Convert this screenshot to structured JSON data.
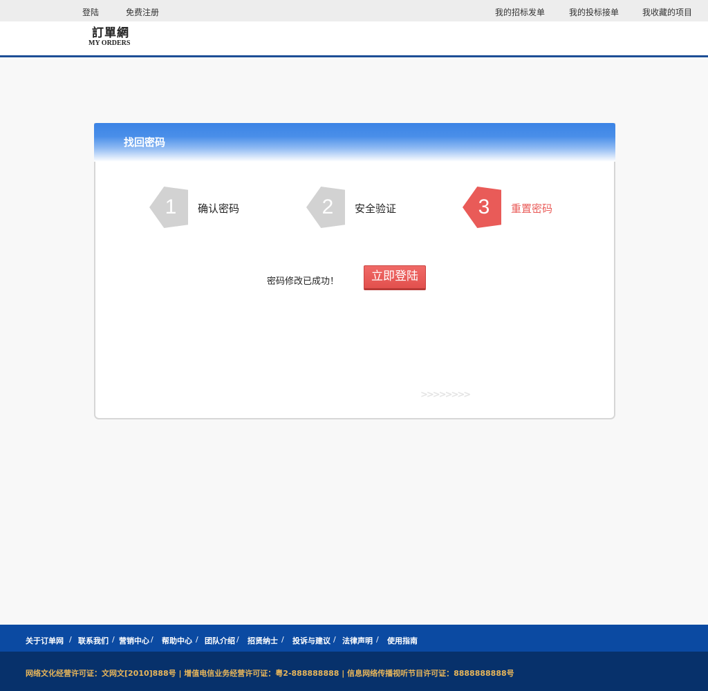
{
  "topbar": {
    "login": "登陆",
    "register": "免费注册",
    "my_bids_posted": "我的招标发单",
    "my_bids_received": "我的投标接单",
    "my_favorites": "我收藏的项目"
  },
  "logo": {
    "cn": "訂單網",
    "en": "MY ORDERS"
  },
  "card": {
    "title": "找回密码",
    "steps": [
      {
        "number": "1",
        "label": "确认密码",
        "state": "done"
      },
      {
        "number": "2",
        "label": "安全验证",
        "state": "done"
      },
      {
        "number": "3",
        "label": "重置密码",
        "state": "active"
      }
    ],
    "success_message": "密码修改已成功！",
    "login_button": "立即登陆",
    "chevrons": ">>>>>>>>"
  },
  "footer": {
    "nav": [
      "关于订单网",
      "联系我们",
      "营销中心",
      "帮助中心",
      "团队介绍",
      "招贤纳士",
      "投诉与建议",
      "法律声明",
      "使用指南"
    ],
    "separator": "/",
    "license": "网络文化经营许可证：文网文[2010]888号 | 增值电信业务经营许可证：粤2-888888888 | 信息网络传播视听节目许可证：8888888888号"
  },
  "colors": {
    "header_blue": "#1d4e96",
    "card_head_blue": "#3b83e5",
    "accent_red": "#e95b58",
    "footer_nav": "#0b4aa2",
    "footer_license": "#07316b",
    "license_text": "#e8b65a"
  }
}
